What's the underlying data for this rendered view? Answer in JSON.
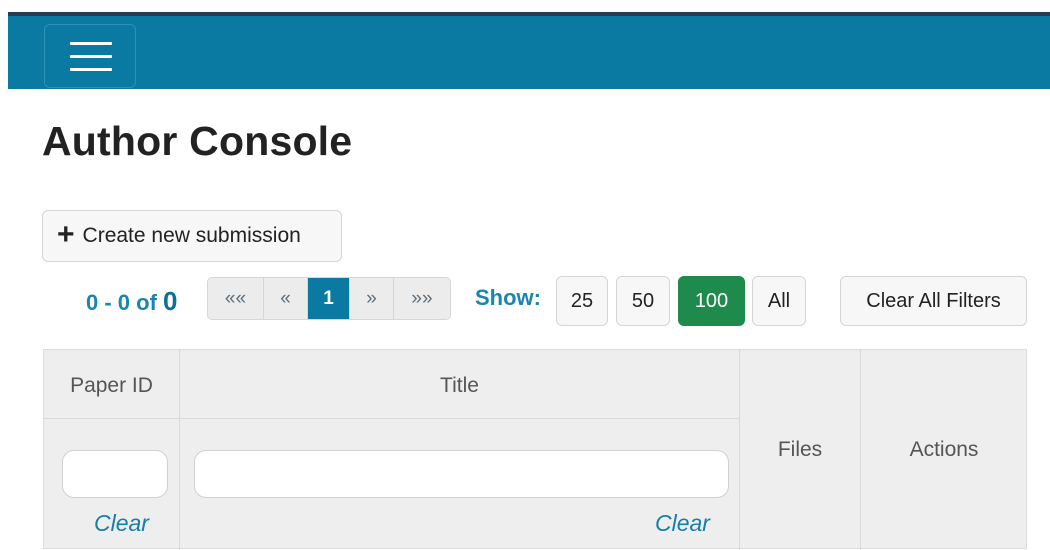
{
  "nav": {
    "menu_icon": "hamburger-menu-icon",
    "bg_color": "#0a7aa3"
  },
  "page": {
    "title": "Author Console"
  },
  "toolbar": {
    "create_icon": "plus-icon",
    "create_label": "Create new submission"
  },
  "pagination": {
    "range": "0 - 0 of",
    "total": "0",
    "first": "««",
    "prev": "«",
    "current": "1",
    "next": "»",
    "last": "»»"
  },
  "page_size": {
    "label": "Show:",
    "options": [
      "25",
      "50",
      "100",
      "All"
    ],
    "selected": "100"
  },
  "filters": {
    "clear_all_label": "Clear All Filters"
  },
  "table": {
    "columns": [
      "Paper ID",
      "Title",
      "Files",
      "Actions"
    ],
    "filter_row": {
      "paper_id_value": "",
      "title_value": "",
      "clear_label": "Clear"
    }
  },
  "colors": {
    "accent": "#0a7aa3",
    "selected_size": "#1e8a4b",
    "link": "#177ea8"
  }
}
